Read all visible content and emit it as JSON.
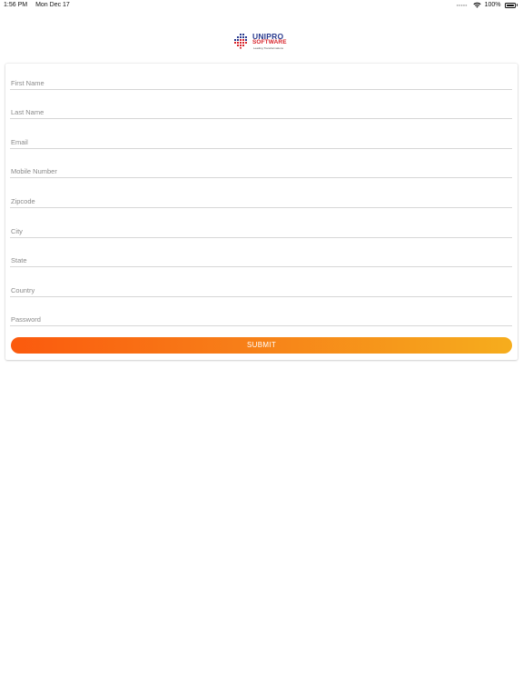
{
  "status_bar": {
    "time": "1:56 PM",
    "date": "Mon Dec 17",
    "battery_percent": "100%",
    "wifi_icon": "wifi-icon",
    "battery_icon": "battery-icon",
    "battery_level": 1.0
  },
  "logo": {
    "line1": "UNIPRO",
    "line2": "SOFTWARE",
    "tagline": "Leading Transformations",
    "colors": {
      "blue": "#2a3b8f",
      "red": "#d8232a"
    }
  },
  "form": {
    "fields": [
      {
        "name": "first-name",
        "placeholder": "First Name",
        "value": ""
      },
      {
        "name": "last-name",
        "placeholder": "Last Name",
        "value": ""
      },
      {
        "name": "email",
        "placeholder": "Email",
        "value": ""
      },
      {
        "name": "mobile-number",
        "placeholder": "Mobile Number",
        "value": ""
      },
      {
        "name": "zipcode",
        "placeholder": "Zipcode",
        "value": ""
      },
      {
        "name": "city",
        "placeholder": "City",
        "value": ""
      },
      {
        "name": "state",
        "placeholder": "State",
        "value": ""
      },
      {
        "name": "country",
        "placeholder": "Country",
        "value": ""
      },
      {
        "name": "password",
        "placeholder": "Password",
        "value": ""
      }
    ],
    "submit_label": "SUBMIT",
    "submit_gradient": [
      "#fb5a0e",
      "#f6ad1d"
    ]
  }
}
